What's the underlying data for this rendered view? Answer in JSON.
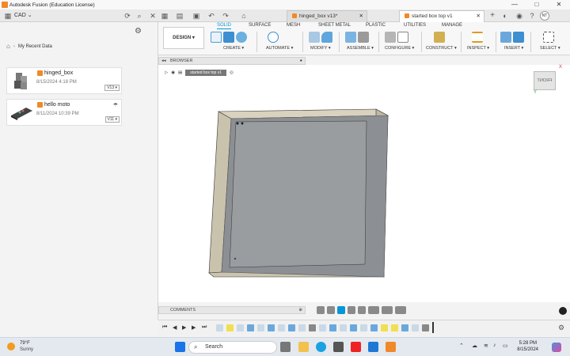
{
  "window": {
    "title": "Autodesk Fusion (Education License)",
    "controls": [
      "—",
      "□",
      "✕"
    ]
  },
  "tabbar": {
    "project_name": "CAD",
    "doc_tabs": [
      {
        "label": "hinged_box v13*",
        "active": false
      },
      {
        "label": "started box top v1",
        "active": true
      }
    ],
    "user_initials": "NT"
  },
  "left_panel": {
    "breadcrumb": "My Recent Data",
    "files": [
      {
        "name": "hinged_box",
        "date": "8/15/2024 4:18 PM",
        "version": "V13 ▾"
      },
      {
        "name": "hello moto",
        "date": "8/11/2024 10:39 PM",
        "version": "V11 ▾"
      }
    ]
  },
  "toolbar": {
    "workspace_tabs": [
      "SOLID",
      "SURFACE",
      "MESH",
      "SHEET METAL",
      "PLASTIC",
      "UTILITIES",
      "MANAGE"
    ],
    "active_tab": "SOLID",
    "design_button": "DESIGN ▾",
    "groups": [
      "CREATE ▾",
      "AUTOMATE ▾",
      "MODIFY ▾",
      "ASSEMBLE ▾",
      "CONFIGURE ▾",
      "CONSTRUCT ▾",
      "INSPECT ▾",
      "INSERT ▾",
      "SELECT ▾"
    ]
  },
  "browser": {
    "label": "BROWSER",
    "component": "started box top v1"
  },
  "viewcube": {
    "face": "FRONT",
    "axis_x": "X",
    "axis_z": "Y"
  },
  "comments": {
    "label": "COMMENTS"
  },
  "taskbar": {
    "weather_temp": "79°F",
    "weather_desc": "Sunny",
    "search_placeholder": "Search",
    "time": "5:28 PM",
    "date": "8/15/2024"
  },
  "colors": {
    "accent": "#0696d7",
    "fusion_orange": "#f0892a",
    "box_frame": "#c9c3ae",
    "box_inner": "#8c8f93"
  }
}
